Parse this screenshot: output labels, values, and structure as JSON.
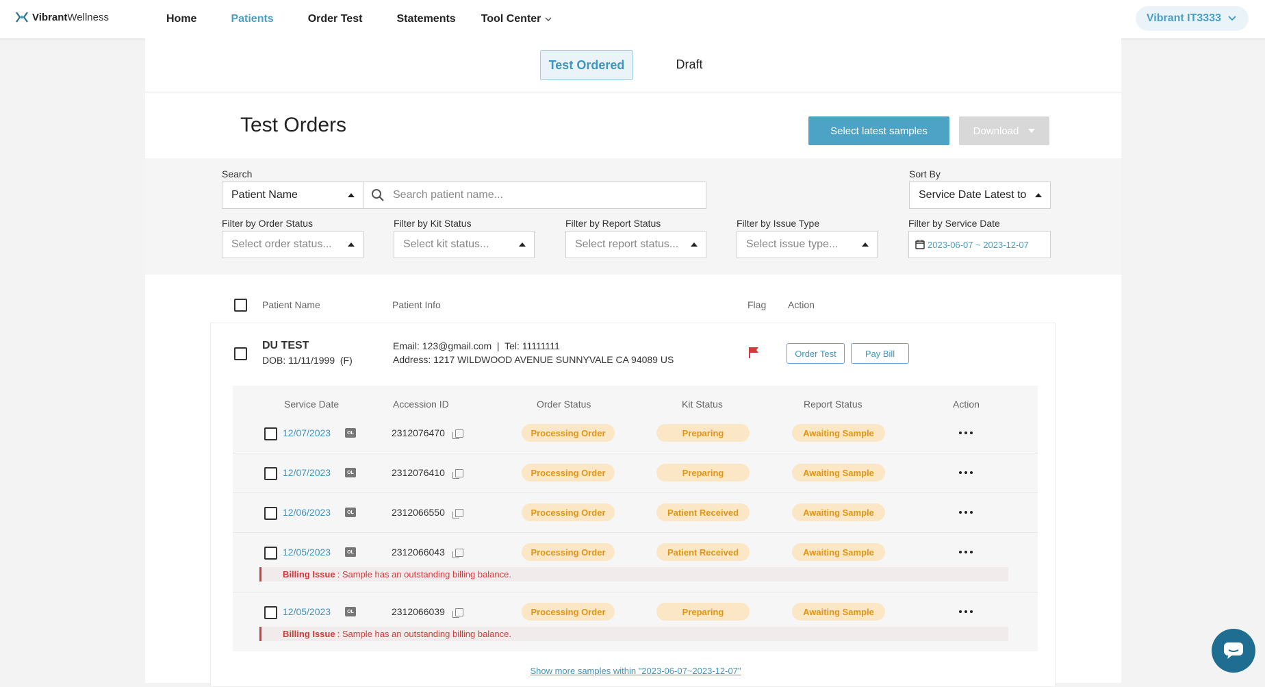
{
  "header": {
    "logo_text_bold": "Vibrant",
    "logo_text": "Wellness",
    "nav": [
      "Home",
      "Patients",
      "Order Test",
      "Statements"
    ],
    "tool_center": "Tool Center",
    "account": "Vibrant IT3333"
  },
  "tabs": {
    "active": "Test Ordered",
    "draft": "Draft"
  },
  "page": {
    "title": "Test Orders",
    "select_latest": "Select latest samples",
    "download": "Download"
  },
  "filters": {
    "search_label": "Search",
    "search_type": "Patient Name",
    "search_placeholder": "Search patient name...",
    "sort_label": "Sort By",
    "sort_value": "Service Date Latest to Oldest",
    "order_status_label": "Filter by Order Status",
    "order_status_placeholder": "Select order status...",
    "kit_status_label": "Filter by Kit Status",
    "kit_status_placeholder": "Select kit status...",
    "report_status_label": "Filter by Report Status",
    "report_status_placeholder": "Select report status...",
    "issue_type_label": "Filter by Issue Type",
    "issue_type_placeholder": "Select issue type...",
    "service_date_label": "Filter by Service Date",
    "service_date_value": "2023-06-07 ~ 2023-12-07"
  },
  "table": {
    "headers": {
      "name": "Patient Name",
      "info": "Patient Info",
      "flag": "Flag",
      "action": "Action"
    }
  },
  "patient": {
    "name": "DU TEST",
    "dob": "DOB: 11/11/1999  (F)",
    "contact": "Email: 123@gmail.com  |  Tel: 11111111",
    "address": "Address: 1217 WILDWOOD AVENUE SUNNYVALE CA 94089 US",
    "order_test": "Order Test",
    "pay_bill": "Pay Bill"
  },
  "samples": {
    "headers": {
      "service_date": "Service Date",
      "accession": "Accession ID",
      "order_status": "Order Status",
      "kit_status": "Kit Status",
      "report_status": "Report Status",
      "action": "Action"
    },
    "ol_badge": "OL",
    "rows": [
      {
        "date": "12/07/2023",
        "accession": "2312076470",
        "order_status": "Processing Order",
        "kit_status": "Preparing",
        "report_status": "Awaiting Sample"
      },
      {
        "date": "12/07/2023",
        "accession": "2312076410",
        "order_status": "Processing Order",
        "kit_status": "Preparing",
        "report_status": "Awaiting Sample"
      },
      {
        "date": "12/06/2023",
        "accession": "2312066550",
        "order_status": "Processing Order",
        "kit_status": "Patient Received",
        "report_status": "Awaiting Sample"
      },
      {
        "date": "12/05/2023",
        "accession": "2312066043",
        "order_status": "Processing Order",
        "kit_status": "Patient Received",
        "report_status": "Awaiting Sample"
      },
      {
        "date": "12/05/2023",
        "accession": "2312066039",
        "order_status": "Processing Order",
        "kit_status": "Preparing",
        "report_status": "Awaiting Sample"
      }
    ],
    "billing_label": "Billing Issue",
    "billing_text": "Sample has an outstanding billing balance.",
    "show_more": "Show more samples within \"2023-06-07~2023-12-07\""
  },
  "colors": {
    "accent": "#4a9ec4",
    "primary_button": "#4ca3c5",
    "badge_bg": "#fbe7c5",
    "badge_text": "#e19613",
    "flag": "#d43a3a",
    "chat": "#1f6d90"
  }
}
